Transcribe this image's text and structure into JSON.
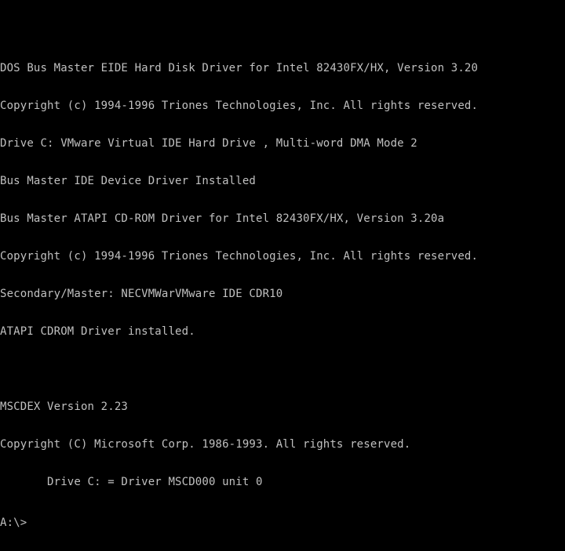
{
  "console": {
    "lines": [
      "DOS Bus Master EIDE Hard Disk Driver for Intel 82430FX/HX, Version 3.20",
      "Copyright (c) 1994-1996 Triones Technologies, Inc. All rights reserved.",
      "Drive C: VMware Virtual IDE Hard Drive , Multi-word DMA Mode 2",
      "Bus Master IDE Device Driver Installed",
      "Bus Master ATAPI CD-ROM Driver for Intel 82430FX/HX, Version 3.20a",
      "Copyright (c) 1994-1996 Triones Technologies, Inc. All rights reserved.",
      "Secondary/Master: NECVMWarVMware IDE CDR10",
      "ATAPI CDROM Driver installed.",
      "",
      "MSCDEX Version 2.23",
      "Copyright (C) Microsoft Corp. 1986-1993. All rights reserved.",
      "       Drive C: = Driver MSCD000 unit 0"
    ],
    "prompt": "A:\\>"
  },
  "colors": {
    "background": "#000000",
    "text": "#c0c0c0"
  }
}
